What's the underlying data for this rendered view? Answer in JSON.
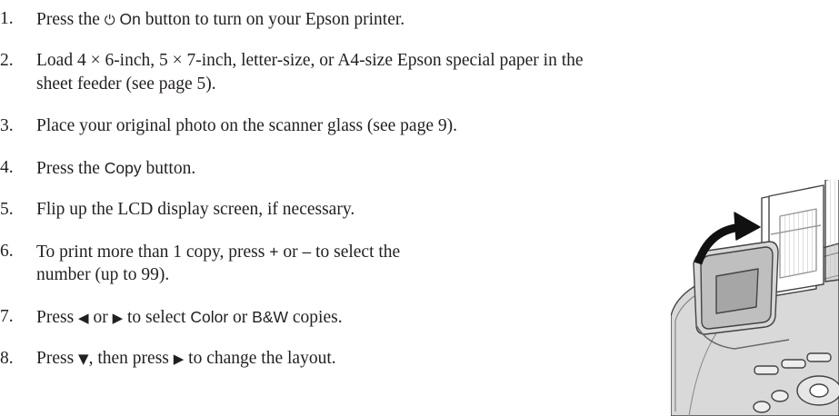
{
  "steps": [
    {
      "num": "1.",
      "a": "Press the ",
      "icon": "⏻",
      "b": " On",
      "c": " button to turn on your Epson printer."
    },
    {
      "num": "2.",
      "line1": "Load 4 × 6-inch, 5 × 7-inch, letter-size, or A4-size Epson special paper in the",
      "line2": "sheet feeder (see page 5)."
    },
    {
      "num": "3.",
      "text": "Place your original photo on the scanner glass (see page 9)."
    },
    {
      "num": "4.",
      "a": "Press the ",
      "b": "Copy",
      "c": " button."
    },
    {
      "num": "5.",
      "text": "Flip up the LCD display screen, if necessary."
    },
    {
      "num": "6.",
      "a": "To print more than 1 copy, press ",
      "plus": "+",
      "or": " or ",
      "minus": "–",
      "c": " to select the",
      "line2": "number (up to 99)."
    },
    {
      "num": "7.",
      "a": "Press ",
      "left": "◀",
      "or": " or ",
      "right": "▶",
      "c": " to select ",
      "color": "Color",
      "or2": " or ",
      "bw": "B&W",
      "d": " copies."
    },
    {
      "num": "8.",
      "a": "Press ",
      "down": "▼",
      "b": ", then press ",
      "right": "▶",
      "c": " to change the layout."
    }
  ]
}
